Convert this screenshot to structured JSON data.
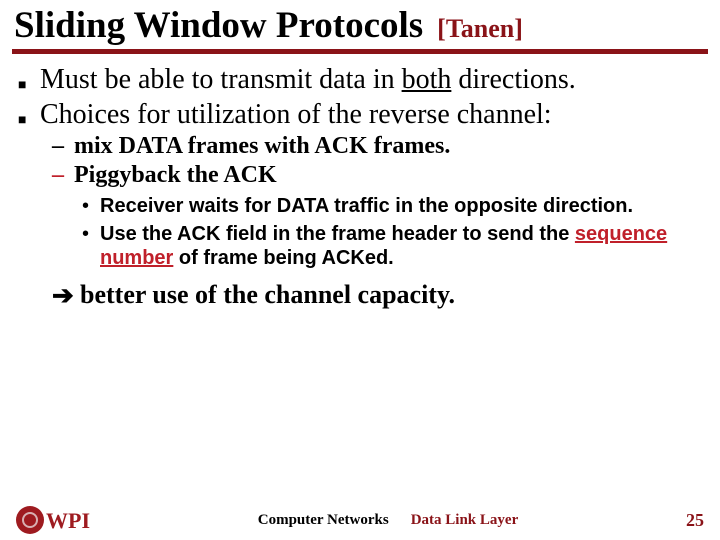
{
  "title": "Sliding Window Protocols",
  "title_cite": "[Tanen]",
  "bullets": [
    {
      "pre": "Must be able to transmit data in ",
      "u": "both",
      "post": " directions."
    },
    {
      "pre": "Choices for utilization of the reverse channel:",
      "u": "",
      "post": ""
    }
  ],
  "sub": [
    {
      "text": "mix DATA frames with ACK frames.",
      "red": false
    },
    {
      "text": "Piggyback the ACK",
      "red": true
    }
  ],
  "subsub": [
    {
      "pre": "Receiver waits for DATA traffic in the opposite direction.",
      "hi": "",
      "post": ""
    },
    {
      "pre": "Use the ACK field in the frame header to send the ",
      "hi": "sequence number",
      "post": " of frame being ACKed."
    }
  ],
  "conclusion": "better use of the channel capacity.",
  "footer": {
    "logo_text": "WPI",
    "center_left": "Computer Networks",
    "center_right": "Data Link Layer",
    "page": "25"
  }
}
